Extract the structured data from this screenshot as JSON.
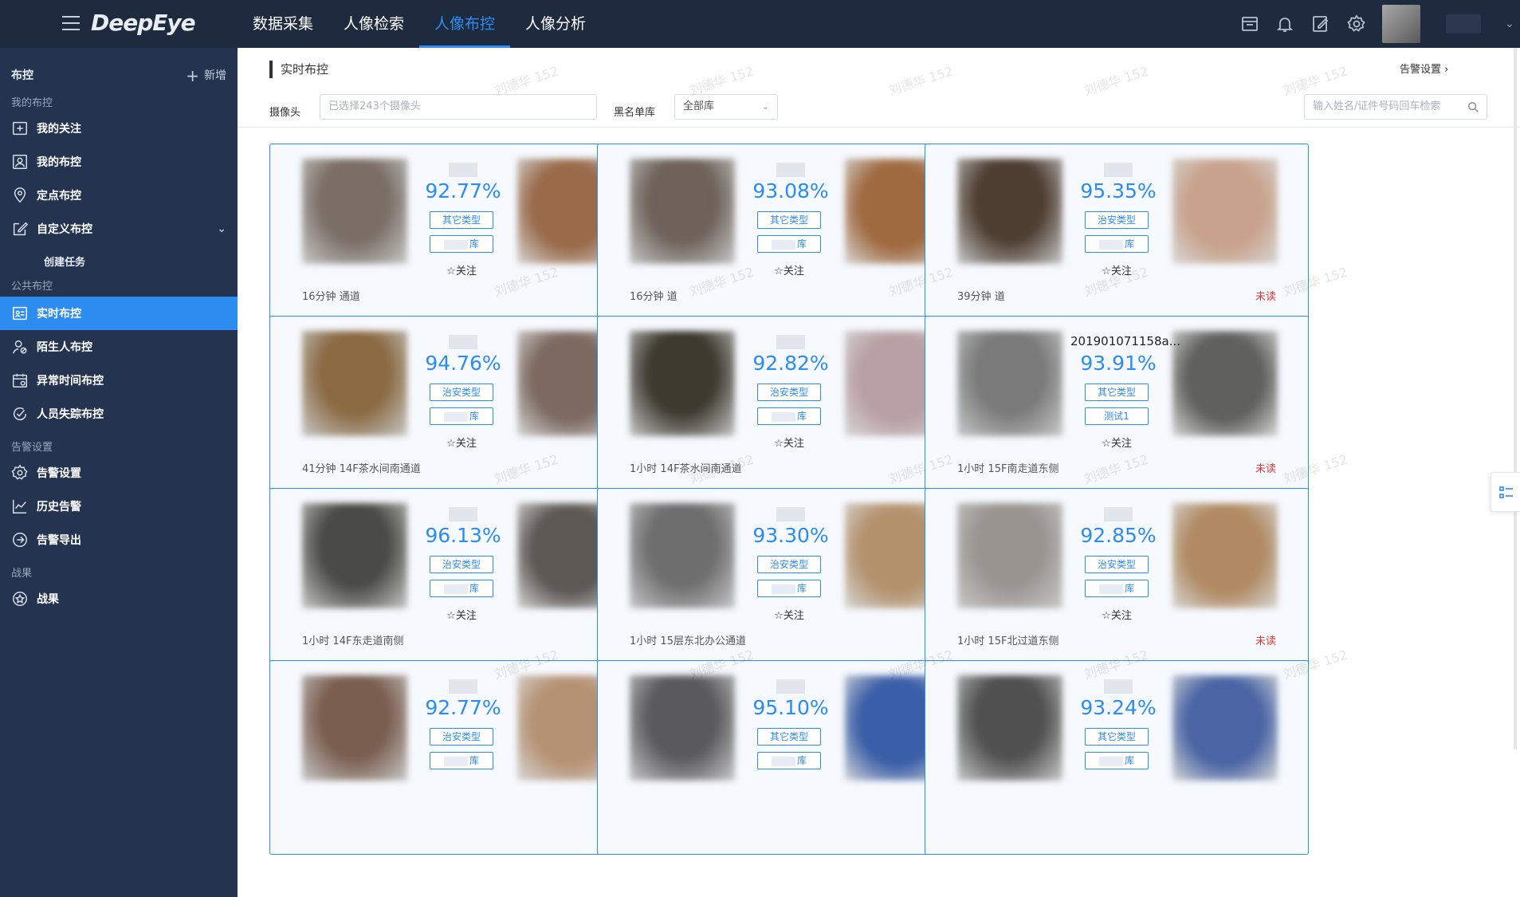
{
  "app": {
    "logo": "DeepEye"
  },
  "topnav": [
    {
      "label": "数据采集",
      "active": false
    },
    {
      "label": "人像检索",
      "active": false
    },
    {
      "label": "人像布控",
      "active": true
    },
    {
      "label": "人像分析",
      "active": false
    }
  ],
  "top_icons": [
    "monitor-icon",
    "bell-icon",
    "edit-icon",
    "settings-icon"
  ],
  "sidebar": {
    "title": "布控",
    "add_label": "新增",
    "groups": [
      {
        "label": "我的布控"
      },
      {
        "label": "公共布控"
      },
      {
        "label": "告警设置"
      },
      {
        "label": "战果"
      }
    ],
    "items": [
      {
        "label": "我的关注",
        "icon": "plus-square-icon"
      },
      {
        "label": "我的布控",
        "icon": "user-card-icon"
      },
      {
        "label": "定点布控",
        "icon": "location-pin-icon"
      },
      {
        "label": "自定义布控",
        "icon": "edit-box-icon"
      },
      {
        "label": "实时布控",
        "icon": "realtime-icon"
      },
      {
        "label": "陌生人布控",
        "icon": "stranger-icon"
      },
      {
        "label": "异常时间布控",
        "icon": "calendar-icon"
      },
      {
        "label": "人员失踪布控",
        "icon": "missing-icon"
      },
      {
        "label": "告警设置",
        "icon": "gear-icon"
      },
      {
        "label": "历史告警",
        "icon": "chart-line-icon"
      },
      {
        "label": "告警导出",
        "icon": "export-icon"
      },
      {
        "label": "战果",
        "icon": "star-circle-icon"
      }
    ],
    "sub_item": "创建任务",
    "active_item": "实时布控"
  },
  "main": {
    "page_title": "实时布控",
    "alarm_settings_link": "告警设置",
    "filters": {
      "camera_label": "摄像头",
      "camera_placeholder": "已选择243个摄像头",
      "blacklist_label": "黑名单库",
      "blacklist_value": "全部库",
      "search_placeholder": "输入姓名/证件号码回车检索"
    },
    "follow_label": "☆关注",
    "unread_label": "未读",
    "cards": [
      {
        "score": "92.77%",
        "tag1": "其它类型",
        "tag2": "库",
        "time": "16分钟",
        "location": "通道",
        "name": ""
      },
      {
        "score": "93.08%",
        "tag1": "其它类型",
        "tag2": "库",
        "time": "16分钟",
        "location": "道",
        "name": ""
      },
      {
        "score": "95.35%",
        "tag1": "治安类型",
        "tag2": "库",
        "time": "39分钟",
        "location": "道",
        "name": ""
      },
      {
        "score": "94.76%",
        "tag1": "治安类型",
        "tag2": "库",
        "time": "41分钟",
        "location": "14F茶水间南通道",
        "name": ""
      },
      {
        "score": "92.82%",
        "tag1": "治安类型",
        "tag2": "库",
        "time": "1小时",
        "location": "14F茶水间南通道",
        "name": ""
      },
      {
        "score": "93.91%",
        "tag1": "其它类型",
        "tag2": "测试1",
        "time": "1小时",
        "location": "15F南走道东侧",
        "name": "201901071158a..."
      },
      {
        "score": "96.13%",
        "tag1": "治安类型",
        "tag2": "库",
        "time": "1小时",
        "location": "14F东走道南侧",
        "name": ""
      },
      {
        "score": "93.30%",
        "tag1": "治安类型",
        "tag2": "库",
        "time": "1小时",
        "location": "15层东北办公通道",
        "name": ""
      },
      {
        "score": "92.85%",
        "tag1": "治安类型",
        "tag2": "库",
        "time": "1小时",
        "location": "15F北过道东侧",
        "name": ""
      },
      {
        "score": "92.77%",
        "tag1": "治安类型",
        "tag2": "库",
        "time": "",
        "location": "",
        "name": ""
      },
      {
        "score": "95.10%",
        "tag1": "其它类型",
        "tag2": "库",
        "time": "",
        "location": "",
        "name": ""
      },
      {
        "score": "93.24%",
        "tag1": "其它类型",
        "tag2": "库",
        "time": "",
        "location": "",
        "name": ""
      }
    ]
  },
  "watermark": "刘德华 152",
  "colors": {
    "accent": "#2d8cf0",
    "sidebar": "#243350",
    "topbar": "#1e2a3d",
    "unread": "#e53935"
  }
}
